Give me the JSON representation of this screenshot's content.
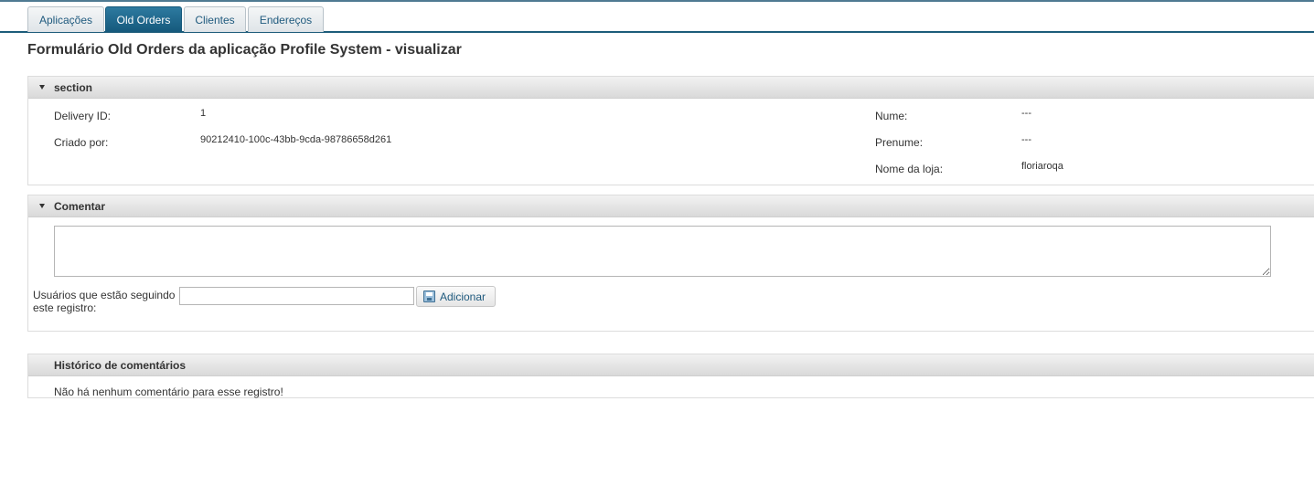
{
  "tabs": [
    {
      "label": "Aplicações",
      "active": false
    },
    {
      "label": "Old Orders",
      "active": true
    },
    {
      "label": "Clientes",
      "active": false
    },
    {
      "label": "Endereços",
      "active": false
    }
  ],
  "page": {
    "title": "Formulário Old Orders da aplicação Profile System - visualizar"
  },
  "section": {
    "title": "section",
    "fields": [
      {
        "label": "Delivery ID:",
        "value": "1"
      },
      {
        "label": "Criado por:",
        "value": "90212410-100c-43bb-9cda-98786658d261"
      },
      {
        "label": "Nume:",
        "value": "---"
      },
      {
        "label": "Prenume:",
        "value": "---"
      },
      {
        "label": "Nome da loja:",
        "value": "floriaroqa"
      }
    ]
  },
  "comment": {
    "title": "Comentar",
    "textarea_value": "",
    "followers_label": "Usuários que estão seguindo este registro:",
    "followers_value": "",
    "add_button_label": "Adicionar"
  },
  "history": {
    "title": "Histórico de comentários",
    "empty_text": "Não há nenhum comentário para esse registro!"
  },
  "icons": {
    "panel_toggle": "caret-down-icon",
    "add_button": "floppy-disk-icon"
  },
  "colors": {
    "accent": "#1d5c7a",
    "active_tab": "#15597c",
    "link_text": "#1f5a7e"
  }
}
